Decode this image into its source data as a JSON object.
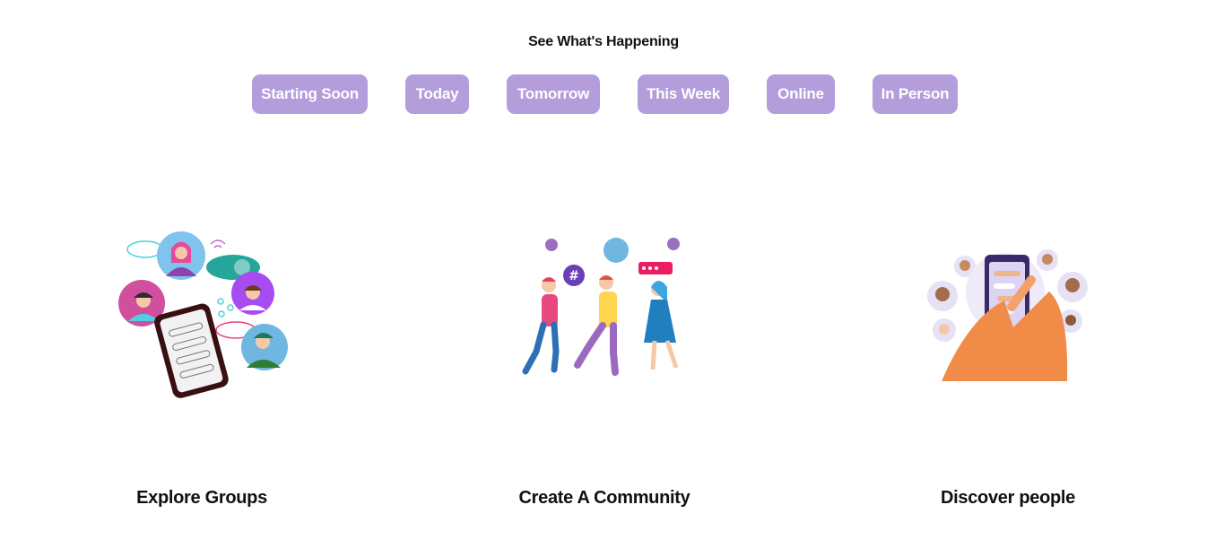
{
  "header": {
    "title": "See What's Happening"
  },
  "filters": [
    {
      "label": "Starting Soon"
    },
    {
      "label": "Today"
    },
    {
      "label": "Tomorrow"
    },
    {
      "label": "This Week"
    },
    {
      "label": "Online"
    },
    {
      "label": "In Person"
    }
  ],
  "features": [
    {
      "title": "Explore Groups",
      "icon": "explore-groups-illustration"
    },
    {
      "title": "Create A Community",
      "icon": "create-community-illustration"
    },
    {
      "title": "Discover people",
      "icon": "discover-people-illustration"
    }
  ],
  "colors": {
    "chip_bg": "#b39ddb",
    "chip_text": "#ffffff",
    "heading": "#111111"
  }
}
